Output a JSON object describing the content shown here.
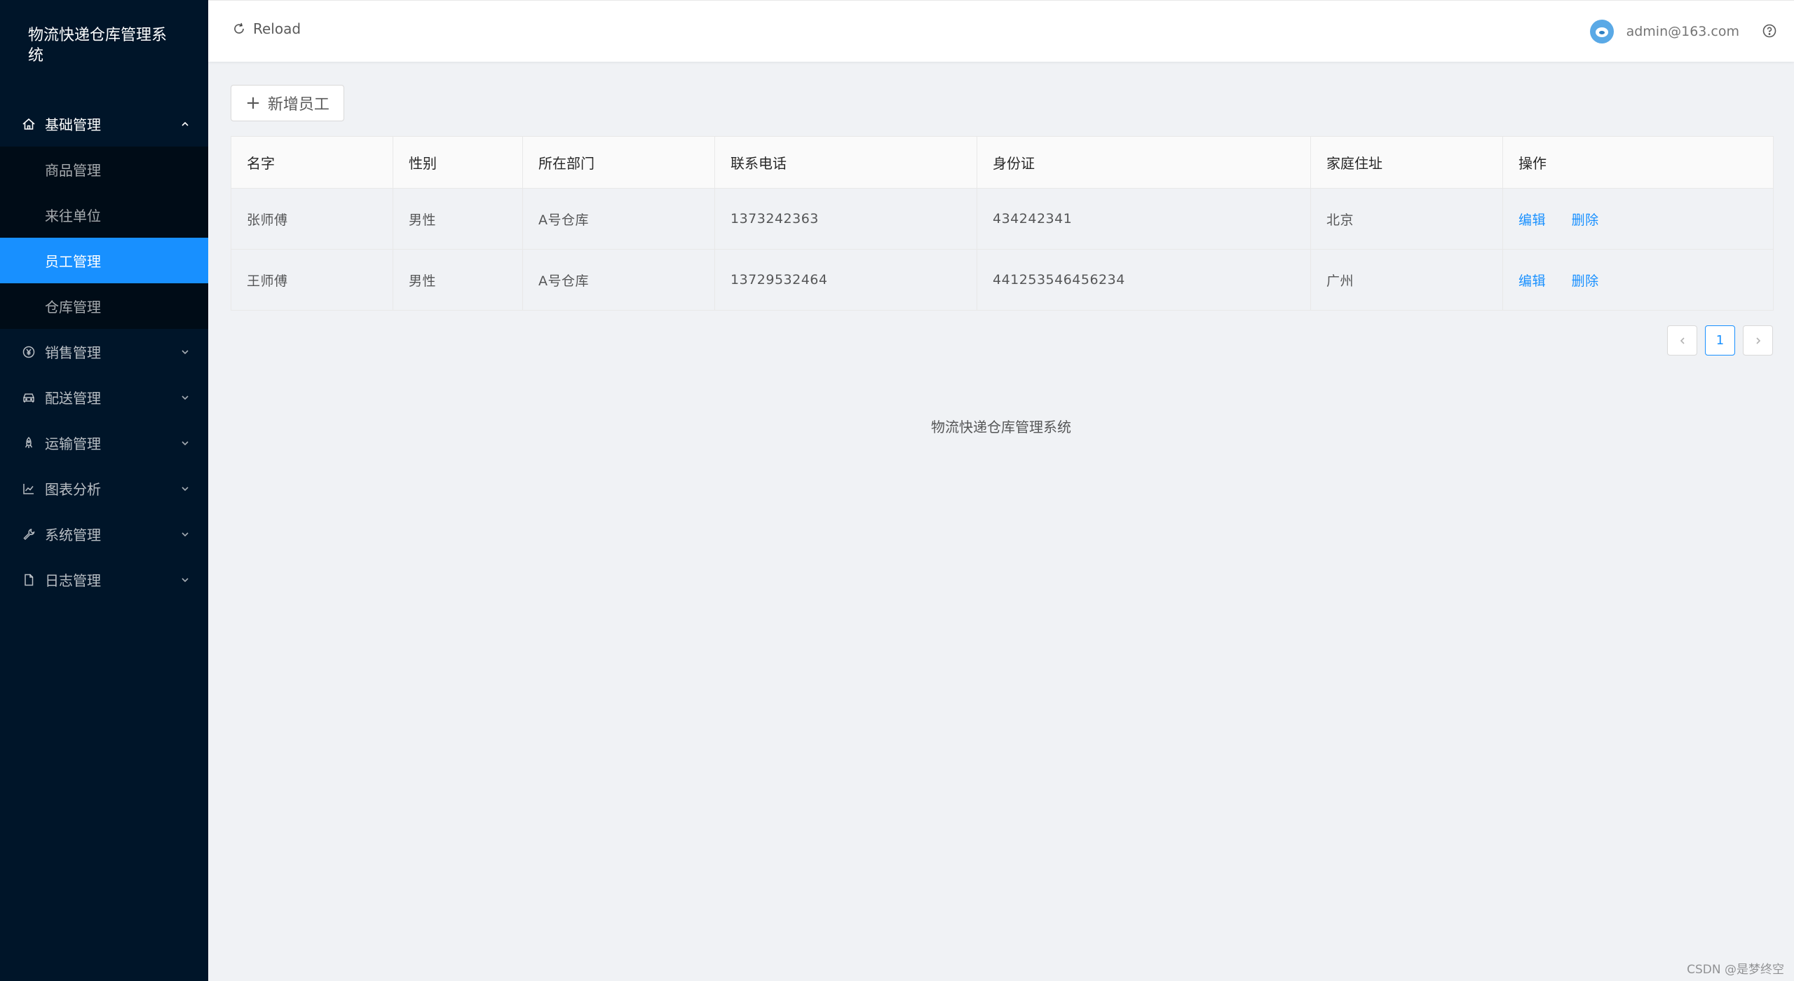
{
  "app": {
    "title": "物流快递仓库管理系统"
  },
  "sidebar": {
    "groups": [
      {
        "label": "基础管理",
        "icon": "home-icon",
        "open": true,
        "items": [
          {
            "label": "商品管理"
          },
          {
            "label": "来往单位"
          },
          {
            "label": "员工管理",
            "selected": true
          },
          {
            "label": "仓库管理"
          }
        ]
      },
      {
        "label": "销售管理",
        "icon": "yen-circle-icon"
      },
      {
        "label": "配送管理",
        "icon": "car-icon"
      },
      {
        "label": "运输管理",
        "icon": "rocket-icon"
      },
      {
        "label": "图表分析",
        "icon": "line-chart-icon"
      },
      {
        "label": "系统管理",
        "icon": "tool-icon"
      },
      {
        "label": "日志管理",
        "icon": "file-icon"
      }
    ]
  },
  "header": {
    "reload_label": "Reload",
    "user_email": "admin@163.com"
  },
  "toolbar": {
    "add_label": "新增员工"
  },
  "table": {
    "columns": [
      "名字",
      "性别",
      "所在部门",
      "联系电话",
      "身份证",
      "家庭住址",
      "操作"
    ],
    "rows": [
      {
        "name": "张师傅",
        "gender": "男性",
        "dept": "A号仓库",
        "phone": "1373242363",
        "id_card": "434242341",
        "address": "北京"
      },
      {
        "name": "王师傅",
        "gender": "男性",
        "dept": "A号仓库",
        "phone": "13729532464",
        "id_card": "441253546456234",
        "address": "广州"
      }
    ],
    "actions": {
      "edit": "编辑",
      "delete": "删除"
    }
  },
  "pagination": {
    "current": "1"
  },
  "footer": {
    "text": "物流快递仓库管理系统"
  },
  "watermark": "CSDN @是梦终空",
  "colors": {
    "sider": "#001529",
    "submenu": "#000c17",
    "primary": "#1890ff",
    "content_bg": "#f0f2f5"
  }
}
